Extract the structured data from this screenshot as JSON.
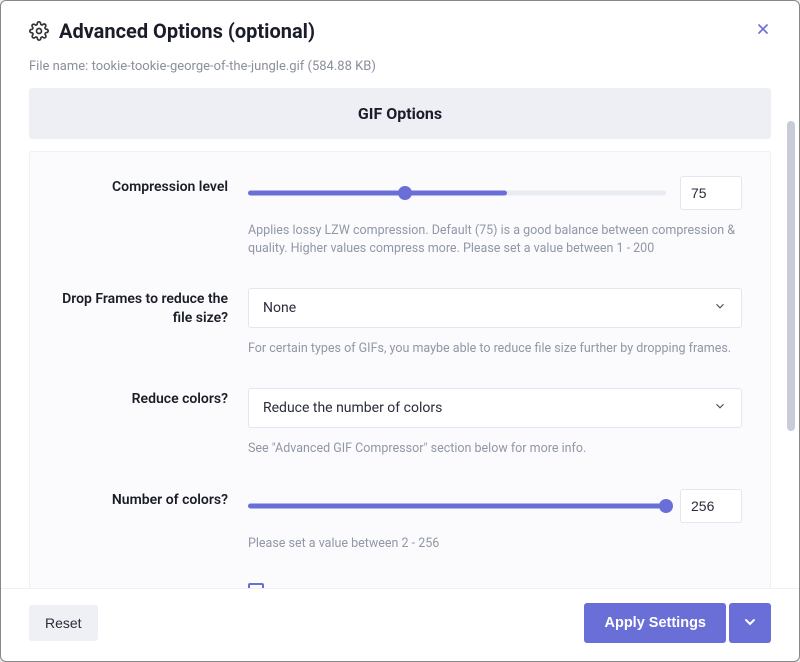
{
  "header": {
    "title": "Advanced Options (optional)"
  },
  "file": {
    "label": "File name:",
    "value": "tookie-tookie-george-of-the-jungle.gif (584.88 KB)"
  },
  "section_title": "GIF Options",
  "compression": {
    "label": "Compression level",
    "value": "75",
    "fill_percent": 37.5,
    "track_filled_percent": 62,
    "help": "Applies lossy LZW compression. Default (75) is a good balance between compression & quality. Higher values compress more. Please set a value between 1 - 200"
  },
  "drop_frames": {
    "label": "Drop Frames to reduce the file size?",
    "selected": "None",
    "help": "For certain types of GIFs, you maybe able to reduce file size further by dropping frames."
  },
  "reduce_colors": {
    "label": "Reduce colors?",
    "selected": "Reduce the number of colors",
    "help": "See \"Advanced GIF Compressor\" section below for more info."
  },
  "num_colors": {
    "label": "Number of colors?",
    "value": "256",
    "fill_percent": 100,
    "help": "Please set a value between 2 - 256"
  },
  "footer": {
    "reset": "Reset",
    "apply": "Apply Settings"
  }
}
